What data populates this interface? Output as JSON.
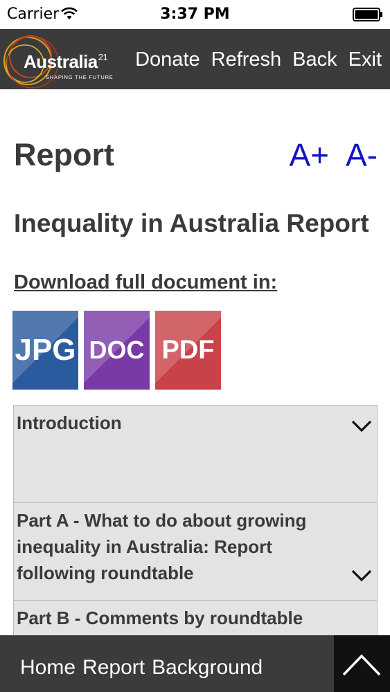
{
  "status_bar": {
    "carrier": "Carrier",
    "time": "3:37 PM"
  },
  "header": {
    "logo_text": "Australia",
    "logo_superscript": "21",
    "logo_tagline": "SHAPING THE FUTURE",
    "nav": [
      "Donate",
      "Refresh",
      "Back",
      "Exit"
    ]
  },
  "page": {
    "title": "Report",
    "font_increase": "A+",
    "font_decrease": "A-",
    "report_title": "Inequality in Australia Report",
    "download_label": "Download full document in:",
    "downloads": [
      {
        "label": "JPG",
        "color": "#2b5b9f"
      },
      {
        "label": "DOC",
        "color": "#7a3aa6"
      },
      {
        "label": "PDF",
        "color": "#c8424a"
      }
    ]
  },
  "accordion": [
    {
      "title": "Introduction"
    },
    {
      "title": "Part A - What to do about growing inequality in Australia: Report following roundtable"
    },
    {
      "title": "Part B - Comments by roundtable"
    }
  ],
  "bottom_nav": [
    "Home",
    "Report",
    "Background"
  ]
}
